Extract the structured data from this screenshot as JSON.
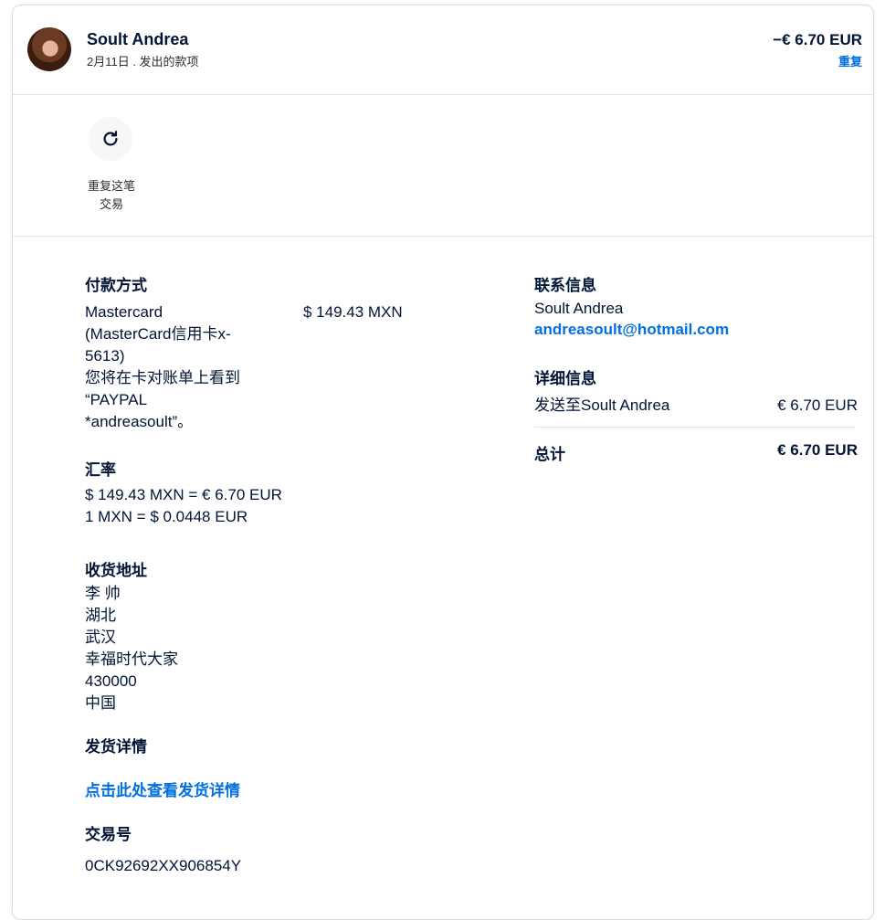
{
  "header": {
    "name": "Soult Andrea",
    "subtitle": "2月11日 . 发出的款项",
    "amount": "−€ 6.70 EUR",
    "repeat_link": "重复"
  },
  "actions": {
    "repeat_label_line1": "重复这笔",
    "repeat_label_line2": "交易",
    "icon": "refresh-icon"
  },
  "payment_method": {
    "title": "付款方式",
    "lines": [
      "Mastercard",
      "(MasterCard信用卡x-",
      "5613)",
      "您将在卡对账单上看到",
      "“PAYPAL",
      "*andreasoult”。"
    ],
    "amount": "$ 149.43 MXN"
  },
  "exchange_rate": {
    "title": "汇率",
    "line1": "$ 149.43 MXN = € 6.70 EUR",
    "line2": "1 MXN = $ 0.0448 EUR"
  },
  "shipping_address": {
    "title": "收货地址",
    "lines": [
      "李 帅",
      "湖北",
      "武汉",
      "幸福时代大家",
      "430000",
      "中国"
    ]
  },
  "shipping_details": {
    "title": "发货详情",
    "link": "点击此处查看发货详情"
  },
  "transaction_id": {
    "title": "交易号",
    "value": "0CK92692XX906854Y"
  },
  "contact": {
    "title": "联系信息",
    "name": "Soult Andrea",
    "email": "andreasoult@hotmail.com"
  },
  "details": {
    "title": "详细信息",
    "item_label": "发送至Soult Andrea",
    "item_amount": "€ 6.70 EUR",
    "total_label": "总计",
    "total_amount": "€ 6.70 EUR"
  },
  "colors": {
    "text": "#001435",
    "link": "#0070e0",
    "divider": "#e3e3e3"
  }
}
